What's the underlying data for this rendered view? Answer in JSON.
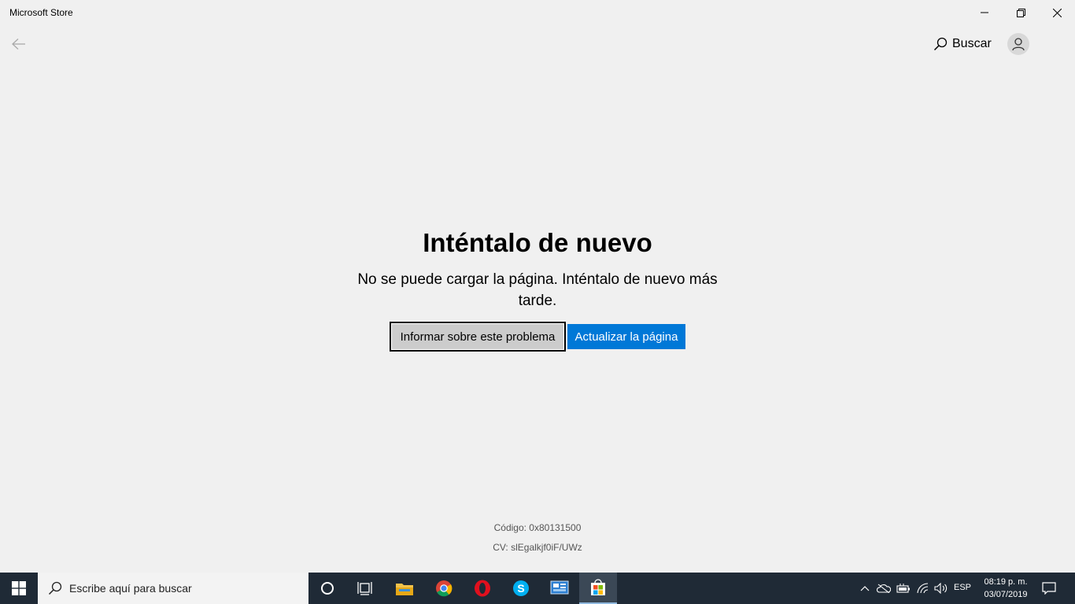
{
  "window": {
    "title": "Microsoft Store",
    "controls": [
      "minimize",
      "restore",
      "close"
    ]
  },
  "header": {
    "search_label": "Buscar"
  },
  "error": {
    "headline": "Inténtalo de nuevo",
    "message": "No se puede cargar la página. Inténtalo de nuevo más tarde.",
    "report_button": "Informar sobre este problema",
    "refresh_button": "Actualizar la página",
    "code": "Código: 0x80131500",
    "cv": "CV: slEgalkjf0iF/UWz"
  },
  "taskbar": {
    "search_placeholder": "Escribe aquí para buscar",
    "apps": [
      "cortana-icon",
      "task-view-icon",
      "file-explorer-icon",
      "chrome-icon",
      "opera-icon",
      "skype-icon",
      "control-panel-icon",
      "store-icon"
    ],
    "active_app": "store-icon",
    "language": "ESP",
    "time": "08:19 p. m.",
    "date": "03/07/2019"
  },
  "colors": {
    "accent": "#0078d7",
    "background": "#f0f0f0",
    "taskbar": "#1f2a36"
  }
}
